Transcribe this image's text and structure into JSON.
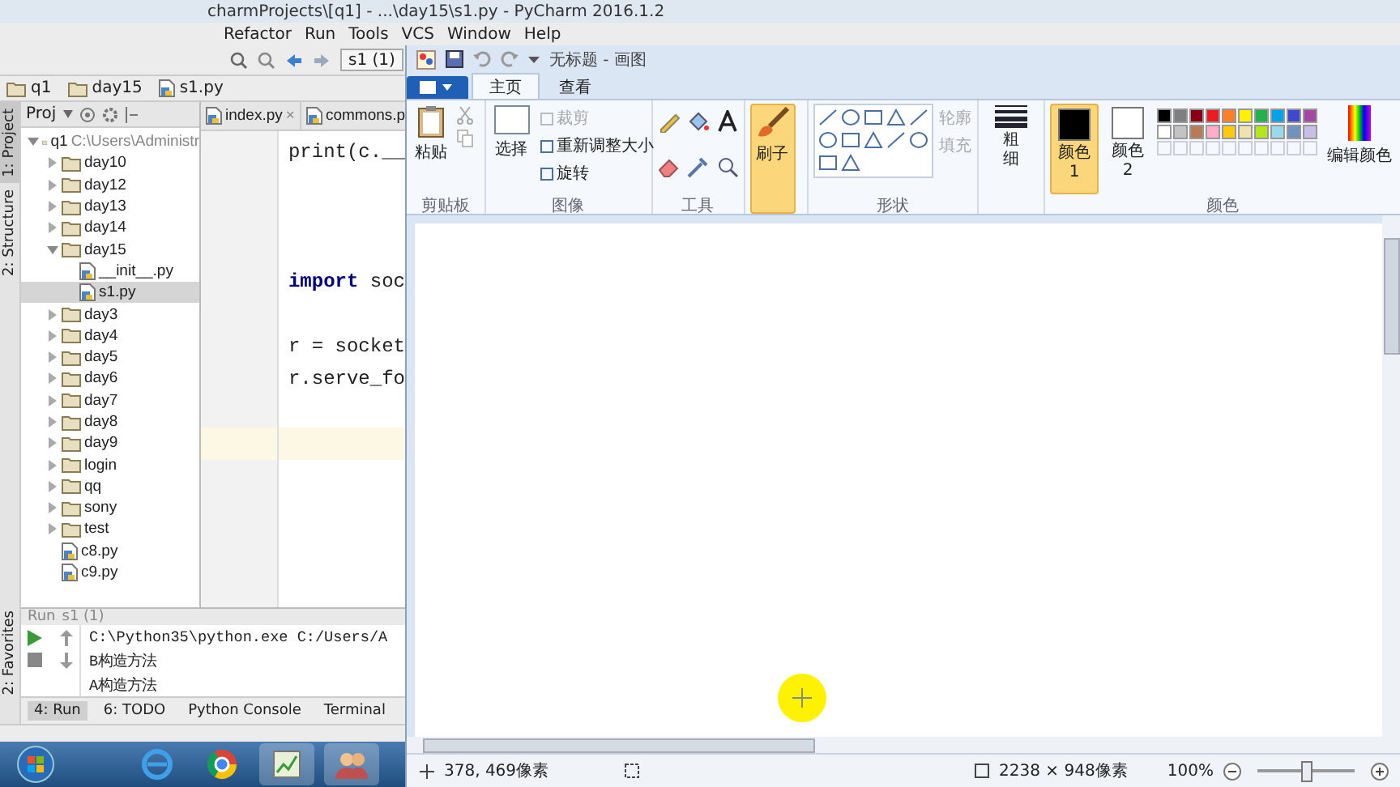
{
  "ide": {
    "title": "charmProjects\\[q1] - ...\\day15\\s1.py - PyCharm 2016.1.2",
    "menu": [
      "Refactor",
      "Run",
      "Tools",
      "VCS",
      "Window",
      "Help"
    ],
    "run_config": "s1 (1)",
    "breadcrumbs": [
      "q1",
      "day15",
      "s1.py"
    ],
    "side_tabs": [
      {
        "label": "1: Project",
        "selected": true
      },
      {
        "label": "2: Structure",
        "selected": false
      }
    ],
    "favorites_tab": "2: Favorites",
    "project_header": "Proj",
    "tree": [
      {
        "name": "q1",
        "path": "C:\\Users\\Administr",
        "kind": "folder",
        "expanded": true,
        "selected": false,
        "children": [
          {
            "name": "day10",
            "kind": "folder",
            "expanded": false,
            "selected": false
          },
          {
            "name": "day12",
            "kind": "folder",
            "expanded": false,
            "selected": false
          },
          {
            "name": "day13",
            "kind": "folder",
            "expanded": false,
            "selected": false
          },
          {
            "name": "day14",
            "kind": "folder",
            "expanded": false,
            "selected": false
          },
          {
            "name": "day15",
            "kind": "folder",
            "expanded": true,
            "selected": false,
            "children": [
              {
                "name": "__init__.py",
                "kind": "file",
                "selected": false
              },
              {
                "name": "s1.py",
                "kind": "file",
                "selected": true
              }
            ]
          },
          {
            "name": "day3",
            "kind": "folder",
            "expanded": false,
            "selected": false
          },
          {
            "name": "day4",
            "kind": "folder",
            "expanded": false,
            "selected": false
          },
          {
            "name": "day5",
            "kind": "folder",
            "expanded": false,
            "selected": false
          },
          {
            "name": "day6",
            "kind": "folder",
            "expanded": false,
            "selected": false
          },
          {
            "name": "day7",
            "kind": "folder",
            "expanded": false,
            "selected": false
          },
          {
            "name": "day8",
            "kind": "folder",
            "expanded": false,
            "selected": false
          },
          {
            "name": "day9",
            "kind": "folder",
            "expanded": false,
            "selected": false
          },
          {
            "name": "login",
            "kind": "folder",
            "expanded": false,
            "selected": false
          },
          {
            "name": "qq",
            "kind": "folder",
            "expanded": false,
            "selected": false
          },
          {
            "name": "sony",
            "kind": "folder",
            "expanded": false,
            "selected": false
          },
          {
            "name": "test",
            "kind": "folder",
            "expanded": false,
            "selected": false
          },
          {
            "name": "c8.py",
            "kind": "file",
            "selected": false
          },
          {
            "name": "c9.py",
            "kind": "file",
            "selected": false
          }
        ]
      }
    ],
    "editor_tabs": [
      {
        "label": "index.py",
        "close": "×"
      },
      {
        "label": "commons.p"
      }
    ],
    "code": [
      {
        "text": "print(c.__",
        "current": false
      },
      {
        "current": false
      },
      {
        "current": false
      },
      {
        "current": false
      },
      {
        "text": "**import** soc",
        "current": false
      },
      {
        "current": false
      },
      {
        "text": "r = socket",
        "current": false
      },
      {
        "text": "r.serve_fo",
        "current": false
      },
      {
        "current": false
      },
      {
        "current": true
      }
    ],
    "run": {
      "title": "Run",
      "config": "s1 (1)",
      "output": [
        "C:\\Python35\\python.exe C:/Users/A",
        "B构造方法",
        "A构造方法"
      ]
    },
    "tool_tabs": [
      {
        "label": "4: Run",
        "selected": true
      },
      {
        "label": "6: TODO",
        "selected": false
      },
      {
        "label": "Python Console",
        "selected": false
      },
      {
        "label": "Terminal",
        "selected": false
      }
    ]
  },
  "paint": {
    "title": "无标题 - 画图",
    "tabs": [
      {
        "label": "主页",
        "selected": true
      },
      {
        "label": "查看",
        "selected": false
      }
    ],
    "clipboard": {
      "paste": "粘贴",
      "label": "剪贴板"
    },
    "image": {
      "select": "选择",
      "items": [
        {
          "label": "裁剪",
          "disabled": true
        },
        {
          "label": "重新调整大小",
          "disabled": false
        },
        {
          "label": "旋转",
          "disabled": false
        }
      ],
      "label": "图像"
    },
    "tools_label": "工具",
    "brush": {
      "label": "刷子",
      "selected": true
    },
    "shapes": {
      "items": [
        {
          "label": "轮廓",
          "disabled": true
        },
        {
          "label": "填充",
          "disabled": true
        }
      ],
      "label": "形状"
    },
    "size": "粗细",
    "color1": {
      "label": "颜色 1",
      "selected": true,
      "color": "#000000"
    },
    "color2": {
      "label": "颜色 2",
      "selected": false,
      "color": "#ffffff"
    },
    "palette": [
      {
        "color": "#000000"
      },
      {
        "color": "#7f7f7f"
      },
      {
        "color": "#880015"
      },
      {
        "color": "#ed1c24"
      },
      {
        "color": "#ff7f27"
      },
      {
        "color": "#fff200"
      },
      {
        "color": "#22b14c"
      },
      {
        "color": "#00a2e8"
      },
      {
        "color": "#3f48cc"
      },
      {
        "color": "#a349a4"
      },
      {
        "color": "#ffffff"
      },
      {
        "color": "#c3c3c3"
      },
      {
        "color": "#b97a57"
      },
      {
        "color": "#ffaec9"
      },
      {
        "color": "#ffc90e"
      },
      {
        "color": "#efe4b0"
      },
      {
        "color": "#b5e61d"
      },
      {
        "color": "#99d9ea"
      },
      {
        "color": "#7092be"
      },
      {
        "color": "#c8bfe7"
      }
    ],
    "edit_colors": "编辑颜色",
    "colors_label": "颜色",
    "status": {
      "position": "378, 469像素",
      "size": "2238 × 948像素",
      "zoom": "100%",
      "level": 0.5
    }
  }
}
